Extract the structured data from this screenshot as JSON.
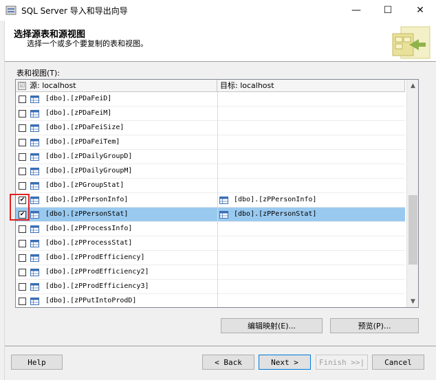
{
  "window": {
    "title": "SQL Server 导入和导出向导",
    "min_glyph": "—",
    "max_glyph": "☐",
    "close_glyph": "✕"
  },
  "header": {
    "title": "选择源表和源视图",
    "subtitle": "选择一个或多个要复制的表和视图。"
  },
  "tables_label": "表和视图(T):",
  "grid": {
    "source_header": "源: localhost",
    "dest_header": "目标: localhost",
    "rows": [
      {
        "src": "[dbo].[zPDaFeiD]",
        "checked": false,
        "dst": ""
      },
      {
        "src": "[dbo].[zPDaFeiM]",
        "checked": false,
        "dst": ""
      },
      {
        "src": "[dbo].[zPDaFeiSize]",
        "checked": false,
        "dst": ""
      },
      {
        "src": "[dbo].[zPDaFeiTem]",
        "checked": false,
        "dst": ""
      },
      {
        "src": "[dbo].[zPDailyGroupD]",
        "checked": false,
        "dst": ""
      },
      {
        "src": "[dbo].[zPDailyGroupM]",
        "checked": false,
        "dst": ""
      },
      {
        "src": "[dbo].[zPGroupStat]",
        "checked": false,
        "dst": ""
      },
      {
        "src": "[dbo].[zPPersonInfo]",
        "checked": true,
        "dst": "[dbo].[zPPersonInfo]"
      },
      {
        "src": "[dbo].[zPPersonStat]",
        "checked": true,
        "dst": "[dbo].[zPPersonStat]",
        "selected": true
      },
      {
        "src": "[dbo].[zPProcessInfo]",
        "checked": false,
        "dst": ""
      },
      {
        "src": "[dbo].[zPProcessStat]",
        "checked": false,
        "dst": ""
      },
      {
        "src": "[dbo].[zPProdEfficiency]",
        "checked": false,
        "dst": ""
      },
      {
        "src": "[dbo].[zPProdEfficiency2]",
        "checked": false,
        "dst": ""
      },
      {
        "src": "[dbo].[zPProdEfficiency3]",
        "checked": false,
        "dst": ""
      },
      {
        "src": "[dbo].[zPPutIntoProdD]",
        "checked": false,
        "dst": ""
      }
    ]
  },
  "buttons": {
    "edit_mappings": "编辑映射(E)...",
    "preview": "预览(P)...",
    "help": "Help",
    "back": "< Back",
    "next": "Next >",
    "finish": "Finish >>|",
    "cancel": "Cancel"
  },
  "colors": {
    "selected_row": "#99c9ef",
    "highlight_box": "#e02020"
  }
}
